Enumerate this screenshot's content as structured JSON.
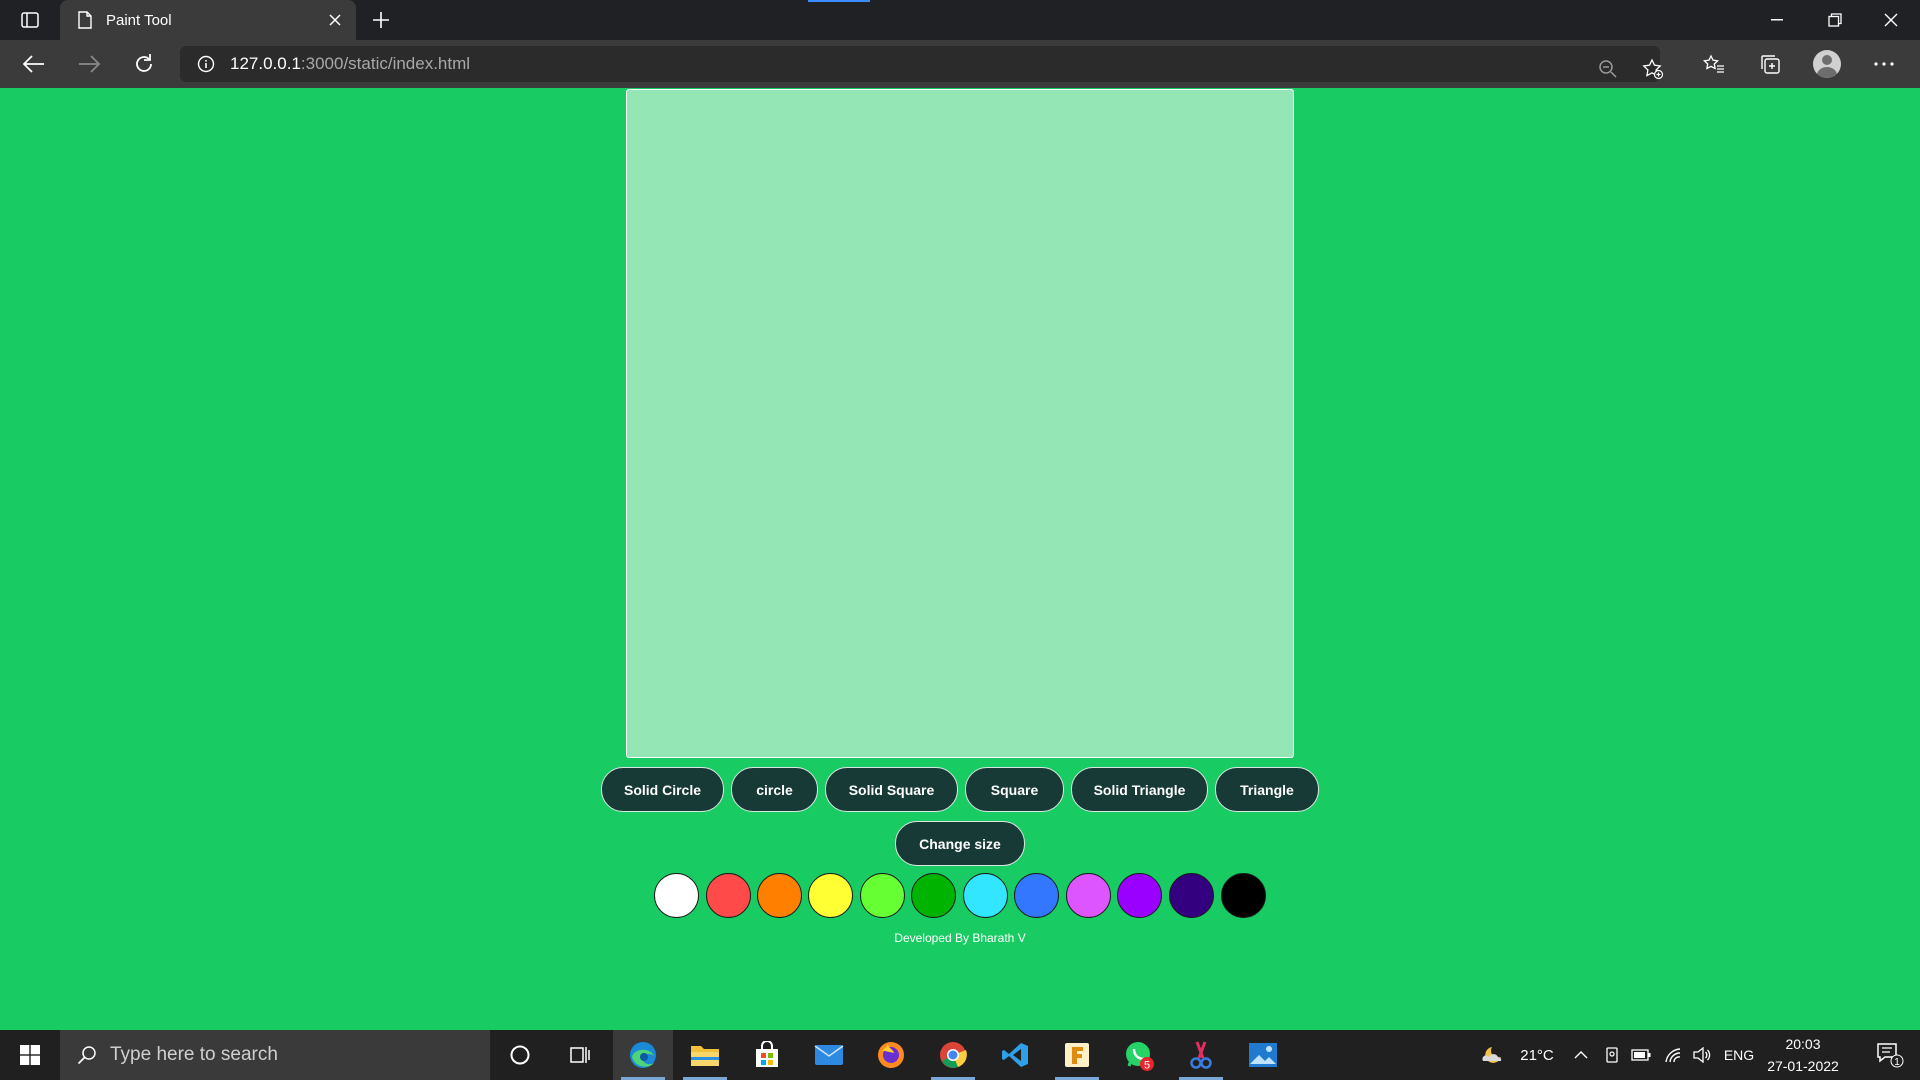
{
  "browser": {
    "tab_title": "Paint Tool",
    "url_host": "127.0.0.1",
    "url_rest": ":3000/static/index.html"
  },
  "page": {
    "shape_buttons": [
      {
        "label": "Solid Circle"
      },
      {
        "label": "circle"
      },
      {
        "label": "Solid Square"
      },
      {
        "label": "Square"
      },
      {
        "label": "Solid Triangle"
      },
      {
        "label": "Triangle"
      }
    ],
    "change_size_label": "Change size",
    "colors": [
      "#ffffff",
      "#ff4a4a",
      "#ff7f00",
      "#ffff33",
      "#66ff33",
      "#00b300",
      "#33e6ff",
      "#3377ff",
      "#dd55ff",
      "#9900ff",
      "#330080",
      "#000000"
    ],
    "credit": "Developed By Bharath V",
    "background_color": "#18cc63",
    "canvas_color": "#94e6b5"
  },
  "taskbar": {
    "search_placeholder": "Type here to search",
    "weather": "21°C",
    "language": "ENG",
    "time": "20:03",
    "date": "27-01-2022",
    "whatsapp_badge": "5",
    "notification_count": "1"
  }
}
